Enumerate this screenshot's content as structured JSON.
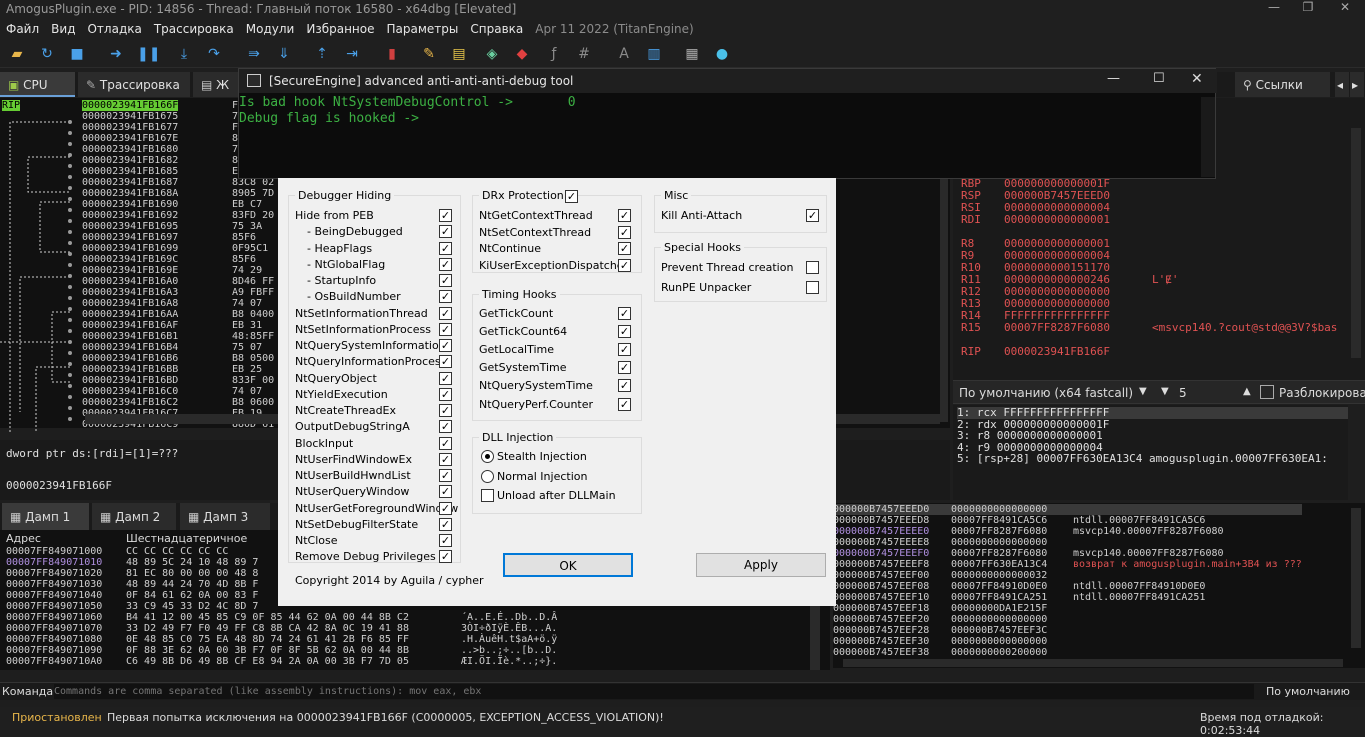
{
  "window": {
    "title": "AmogusPlugin.exe - PID: 14856 - Thread: Главный поток 16580 - x64dbg [Elevated]"
  },
  "menu": {
    "items": [
      "Файл",
      "Вид",
      "Отладка",
      "Трассировка",
      "Модули",
      "Избранное",
      "Параметры",
      "Справка"
    ],
    "date": "Apr 11 2022 (TitanEngine)"
  },
  "tabs": {
    "cpu": "CPU",
    "trace": "Трассировка",
    "refs": "Ссылки",
    "partial": "Ж"
  },
  "cpu": {
    "rip_label": "RIP",
    "addresses": [
      "0000023941FB166F",
      "0000023941FB1675",
      "0000023941FB1677",
      "0000023941FB167E",
      "0000023941FB1680",
      "0000023941FB1682",
      "0000023941FB1685",
      "0000023941FB1687",
      "0000023941FB168A",
      "0000023941FB1690",
      "0000023941FB1692",
      "0000023941FB1695",
      "0000023941FB1697",
      "0000023941FB1699",
      "0000023941FB169C",
      "0000023941FB169E",
      "0000023941FB16A0",
      "0000023941FB16A3",
      "0000023941FB16A8",
      "0000023941FB16AA",
      "0000023941FB16AF",
      "0000023941FB16B1",
      "0000023941FB16B4",
      "0000023941FB16B6",
      "0000023941FB16BB",
      "0000023941FB16BD",
      "0000023941FB16C0",
      "0000023941FB16C2",
      "0000023941FB16C7",
      "0000023941FB16C9"
    ],
    "bytes": [
      "F",
      "7",
      "F",
      "8",
      "7",
      "8",
      "E",
      "83C8 02",
      "8905 7D",
      "EB C7",
      "83FD 20",
      "75 3A",
      "85F6",
      "0F95C1",
      "85F6",
      "74 29",
      "8D46 FF",
      "A9 FBFF",
      "74 07",
      "B8 0400",
      "EB 31",
      "48:85FF",
      "75 07",
      "B8 0500",
      "EB 25",
      "833F 00",
      "74 07",
      "B8 0600",
      "EB 19",
      "880D 61"
    ]
  },
  "info": {
    "line1": "dword ptr ds:[rdi]=[1]=???",
    "line2": "0000023941FB166F"
  },
  "registers": [
    {
      "name": "RBP",
      "value": "000000000000001F",
      "comment": ""
    },
    {
      "name": "RSP",
      "value": "000000B7457EEED0",
      "comment": ""
    },
    {
      "name": "RSI",
      "value": "0000000000000004",
      "comment": ""
    },
    {
      "name": "RDI",
      "value": "0000000000000001",
      "comment": ""
    },
    {
      "name": "R8",
      "value": "0000000000000001",
      "comment": ""
    },
    {
      "name": "R9",
      "value": "0000000000000004",
      "comment": ""
    },
    {
      "name": "R10",
      "value": "0000000000151170",
      "comment": ""
    },
    {
      "name": "R11",
      "value": "0000000000000246",
      "comment": "L'Ɇ'"
    },
    {
      "name": "R12",
      "value": "0000000000000000",
      "comment": ""
    },
    {
      "name": "R13",
      "value": "0000000000000000",
      "comment": ""
    },
    {
      "name": "R14",
      "value": "FFFFFFFFFFFFFFFF",
      "comment": ""
    },
    {
      "name": "R15",
      "value": "00007FF8287F6080",
      "comment": "<msvcp140.?cout@std@@3V?$bas"
    },
    {
      "name": "RIP",
      "value": "0000023941FB166F",
      "comment": ""
    }
  ],
  "callconv": {
    "label": "По умолчанию (x64 fastcall)",
    "count": "5",
    "unlock": "Разблокировано"
  },
  "args": [
    "1: rcx FFFFFFFFFFFFFFFF",
    "2: rdx 000000000000001F",
    "3: r8 0000000000000001",
    "4: r9 0000000000000004",
    "5: [rsp+28] 00007FF630EA13C4 amogusplugin.00007FF630EA1:"
  ],
  "dump": {
    "tabs": [
      "Дамп 1",
      "Дамп 2",
      "Дамп 3"
    ],
    "col_addr": "Адрес",
    "col_hex": "Шестнадцатеричное",
    "rows": [
      {
        "a": "00007FF849071000",
        "h": "CC CC CC CC CC CC",
        "t": ""
      },
      {
        "a": "00007FF849071010",
        "h": "48 89 5C 24 10 48 89 7",
        "t": ""
      },
      {
        "a": "00007FF849071020",
        "h": "81 EC 80 00 00 00 48 8",
        "t": ""
      },
      {
        "a": "00007FF849071030",
        "h": "48 89 44 24 70 4D 8B F",
        "t": ""
      },
      {
        "a": "00007FF849071040",
        "h": "0F 84 61 62 0A 00 83 F",
        "t": ""
      },
      {
        "a": "00007FF849071050",
        "h": "33 C9 45 33 D2 4C 8D 7",
        "t": ""
      },
      {
        "a": "00007FF849071060",
        "h": "B4 41 12 00 45 85 C9 0F 85 44 62 0A 00 44 8B C2",
        "t": "´A..E.É..Db..D.Â"
      },
      {
        "a": "00007FF849071070",
        "h": "33 D2 49 F7 F0 49 FF C8 8B CA 42 8A 0C 19 41 88",
        "t": "3ÒI÷ðIÿÈ.ÊB...A."
      },
      {
        "a": "00007FF849071080",
        "h": "0E 48 85 C0 75 EA 48 8D 74 24 61 41 2B F6 85 FF",
        "t": ".H.ÀuêH.t$aA+ö.ÿ"
      },
      {
        "a": "00007FF849071090",
        "h": "0F 88 3E 62 0A 00 3B F7 0F 8F 5B 62 0A 00 44 8B",
        "t": "..>b..;÷..[b..D."
      },
      {
        "a": "00007FF8490710A0",
        "h": "C6 49 8B D6 49 8B CF E8 94 2A 0A 00 3B F7 7D 05",
        "t": "ÆI.ÖI.Ïè.*..;÷}."
      }
    ]
  },
  "stack": [
    {
      "a": "000000B7457EEED0",
      "v": "0000000000000000",
      "c": ""
    },
    {
      "a": "000000B7457EEED8",
      "v": "00007FF8491CA5C6",
      "c": "ntdll.00007FF8491CA5C6"
    },
    {
      "a": "000000B7457EEEE0",
      "v": "00007FF8287F6080",
      "c": "msvcp140.00007FF8287F6080"
    },
    {
      "a": "000000B7457EEEE8",
      "v": "0000000000000000",
      "c": ""
    },
    {
      "a": "000000B7457EEEF0",
      "v": "00007FF8287F6080",
      "c": "msvcp140.00007FF8287F6080"
    },
    {
      "a": "000000B7457EEEF8",
      "v": "00007FF630EA13C4",
      "c": "возврат к amogusplugin.main+3B4 из ???"
    },
    {
      "a": "000000B7457EEF00",
      "v": "0000000000000032",
      "c": ""
    },
    {
      "a": "000000B7457EEF08",
      "v": "00007FF84910D0E0",
      "c": "ntdll.00007FF84910D0E0"
    },
    {
      "a": "000000B7457EEF10",
      "v": "00007FF8491CA251",
      "c": "ntdll.00007FF8491CA251"
    },
    {
      "a": "000000B7457EEF18",
      "v": "00000000DA1E215F",
      "c": ""
    },
    {
      "a": "000000B7457EEF20",
      "v": "0000000000000000",
      "c": ""
    },
    {
      "a": "000000B7457EEF28",
      "v": "000000B7457EEF3C",
      "c": ""
    },
    {
      "a": "000000B7457EEF30",
      "v": "0000000000000000",
      "c": ""
    },
    {
      "a": "000000B7457EEF38",
      "v": "0000000000200000",
      "c": ""
    }
  ],
  "cmd": {
    "label": "Команда:",
    "placeholder": "Commands are comma separated (like assembly instructions): mov eax, ebx",
    "right": "По умолчанию"
  },
  "status": {
    "state": "Приостановлен",
    "message": "Первая попытка исключения на 0000023941FB166F (C0000005, EXCEPTION_ACCESS_VIOLATION)!",
    "time": "Время под отладкой: 0:02:53:44"
  },
  "se_window": {
    "title": "[SecureEngine] advanced anti-anti-anti-debug tool",
    "line1": "Is bad hook NtSystemDebugControl ->       0",
    "line2": "Debug flag is hooked ->"
  },
  "dialog": {
    "debugger_hiding": {
      "title": "Debugger Hiding",
      "items": [
        {
          "label": "Hide from PEB",
          "checked": true
        },
        {
          "label": "- BeingDebugged",
          "checked": true
        },
        {
          "label": "- HeapFlags",
          "checked": true
        },
        {
          "label": "- NtGlobalFlag",
          "checked": true
        },
        {
          "label": "- StartupInfo",
          "checked": true
        },
        {
          "label": "- OsBuildNumber",
          "checked": true
        },
        {
          "label": "NtSetInformationThread",
          "checked": true
        },
        {
          "label": "NtSetInformationProcess",
          "checked": true
        },
        {
          "label": "NtQuerySystemInformation",
          "checked": true
        },
        {
          "label": "NtQueryInformationProcess",
          "checked": true
        },
        {
          "label": "NtQueryObject",
          "checked": true
        },
        {
          "label": "NtYieldExecution",
          "checked": true
        },
        {
          "label": "NtCreateThreadEx",
          "checked": true
        },
        {
          "label": "OutputDebugStringA",
          "checked": true
        },
        {
          "label": "BlockInput",
          "checked": true
        },
        {
          "label": "NtUserFindWindowEx",
          "checked": true
        },
        {
          "label": "NtUserBuildHwndList",
          "checked": true
        },
        {
          "label": "NtUserQueryWindow",
          "checked": true
        },
        {
          "label": "NtUserGetForegroundWindow",
          "checked": true
        },
        {
          "label": "NtSetDebugFilterState",
          "checked": true
        },
        {
          "label": "NtClose",
          "checked": true
        },
        {
          "label": "Remove Debug Privileges",
          "checked": true
        }
      ]
    },
    "drx": {
      "title": "DRx Protection",
      "checked": true,
      "items": [
        {
          "label": "NtGetContextThread",
          "checked": true
        },
        {
          "label": "NtSetContextThread",
          "checked": true
        },
        {
          "label": "NtContinue",
          "checked": true
        },
        {
          "label": "KiUserExceptionDispatcher",
          "checked": true
        }
      ]
    },
    "timing": {
      "title": "Timing Hooks",
      "items": [
        {
          "label": "GetTickCount",
          "checked": true
        },
        {
          "label": "GetTickCount64",
          "checked": true
        },
        {
          "label": "GetLocalTime",
          "checked": true
        },
        {
          "label": "GetSystemTime",
          "checked": true
        },
        {
          "label": "NtQuerySystemTime",
          "checked": true
        },
        {
          "label": "NtQueryPerf.Counter",
          "checked": true
        }
      ]
    },
    "dll": {
      "title": "DLL Injection",
      "stealth": "Stealth Injection",
      "normal": "Normal Injection",
      "unload": "Unload after DLLMain",
      "selected": "stealth",
      "unload_checked": false
    },
    "misc": {
      "title": "Misc",
      "items": [
        {
          "label": "Kill Anti-Attach",
          "checked": true
        }
      ]
    },
    "special": {
      "title": "Special Hooks",
      "items": [
        {
          "label": "Prevent Thread creation",
          "checked": false
        },
        {
          "label": "RunPE Unpacker",
          "checked": false
        }
      ]
    },
    "copyright": "Copyright 2014 by Aguila / cypher",
    "ok": "OK",
    "apply": "Apply"
  },
  "colors": {
    "rip_highlight": "#66cc33",
    "register_red": "#e05252",
    "console_green": "#3cb043",
    "dialog_bg": "#f0f0f0"
  }
}
